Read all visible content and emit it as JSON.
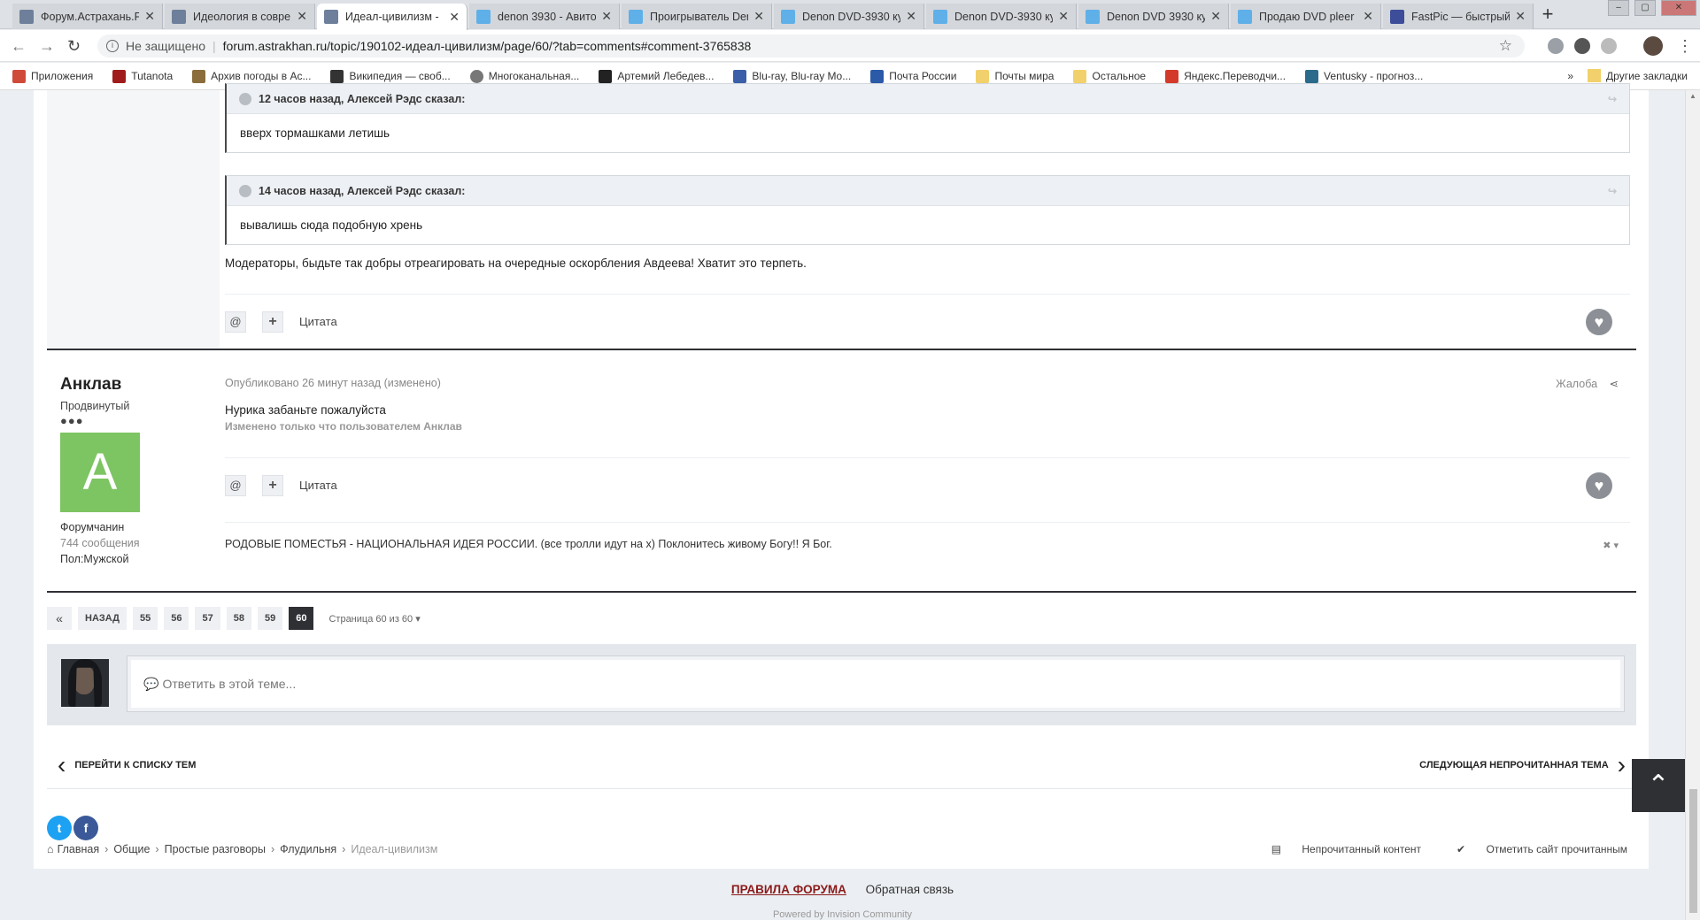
{
  "browser": {
    "tabs": [
      {
        "title": "Форум.Астрахань.Р",
        "color": "#6d7f9a"
      },
      {
        "title": "Идеология в совре",
        "color": "#6d7f9a"
      },
      {
        "title": "Идеал-цивилизм - ",
        "color": "#6d7f9a",
        "active": true
      },
      {
        "title": "denon 3930 - Авито",
        "color": "#5fb0e8"
      },
      {
        "title": "Проигрыватель Den",
        "color": "#5fb0e8"
      },
      {
        "title": "Denon DVD-3930 ку",
        "color": "#5fb0e8"
      },
      {
        "title": "Denon DVD-3930 ку",
        "color": "#5fb0e8"
      },
      {
        "title": "Denon DVD 3930 ку",
        "color": "#5fb0e8"
      },
      {
        "title": "Продаю DVD pleer",
        "color": "#5fb0e8"
      },
      {
        "title": "FastPic — быстрый",
        "color": "#3d4d9a"
      }
    ],
    "address": {
      "security": "Не защищено",
      "url": "forum.astrakhan.ru/topic/190102-идеал-цивилизм/page/60/?tab=comments#comment-3765838"
    },
    "bookmarks": [
      {
        "label": "Приложения",
        "color": "#d04a3a"
      },
      {
        "label": "Tutanota",
        "color": "#a01c1c"
      },
      {
        "label": "Архив погоды в Ас...",
        "color": "#8a6d3b"
      },
      {
        "label": "Википедия — своб...",
        "color": "#333333"
      },
      {
        "label": "Многоканальная...",
        "color": "#777777"
      },
      {
        "label": "Артемий Лебедев...",
        "color": "#222222"
      },
      {
        "label": "Blu-ray, Blu-ray Mo...",
        "color": "#3a5ea8"
      },
      {
        "label": "Почта России",
        "color": "#2a5aa8"
      },
      {
        "label": "Почты мира",
        "color": "#f2d06b"
      },
      {
        "label": "Остальное",
        "color": "#f2d06b"
      },
      {
        "label": "Яндекс.Переводчи...",
        "color": "#d43a2a"
      },
      {
        "label": "Ventusky - прогноз...",
        "color": "#2a6a8a"
      }
    ],
    "other_bookmarks": "Другие закладки"
  },
  "post1": {
    "quote1": {
      "header": "12 часов назад, Алексей Рэдс сказал:",
      "body": "вверх тормашками летишь"
    },
    "quote2": {
      "header": "14 часов назад, Алексей Рэдс сказал:",
      "body": "вывалишь сюда подобную хрень"
    },
    "text": "Модераторы, быдьте так добры отреагировать на очередные оскорбления Авдеева! Хватит это терпеть.",
    "mention": "@",
    "plus": "+",
    "quote_label": "Цитата"
  },
  "post2": {
    "author": "Анклав",
    "rank": "Продвинутый",
    "dots": "●●●",
    "avatar_letter": "A",
    "avatar_color": "#7dc462",
    "group": "Форумчанин",
    "posts": "744 сообщения",
    "sex": "Пол:Мужской",
    "meta": "Опубликовано 26 минут назад (изменено)",
    "report": "Жалоба",
    "text": "Нурика забаньте пожалуйста",
    "edited": "Изменено только что пользователем Анклав",
    "mention": "@",
    "plus": "+",
    "quote_label": "Цитата",
    "signature": "РОДОВЫЕ ПОМЕСТЬЯ - НАЦИОНАЛЬНАЯ ИДЕЯ РОССИИ. (все тролли идут на х) Поклонитесь живому Богу!! Я Бог."
  },
  "pagination": {
    "first": "«",
    "prev": "НАЗАД",
    "pages": [
      "55",
      "56",
      "57",
      "58",
      "59",
      "60"
    ],
    "current": "60",
    "info": "Страница 60 из 60"
  },
  "reply": {
    "placeholder": "Ответить в этой теме..."
  },
  "topic_nav": {
    "back": "ПЕРЕЙТИ К СПИСКУ ТЕМ",
    "next": "СЛЕДУЮЩАЯ НЕПРОЧИТАННАЯ ТЕМА"
  },
  "breadcrumb": [
    "Главная",
    "Общие",
    "Простые разговоры",
    "Флудильня",
    "Идеал-цивилизм"
  ],
  "quick_links": {
    "unread": "Непрочитанный контент",
    "mark_read": "Отметить сайт прочитанным"
  },
  "footer": {
    "rules": "ПРАВИЛА ФОРУМА",
    "contact": "Обратная связь",
    "powered": "Powered by Invision Community"
  }
}
